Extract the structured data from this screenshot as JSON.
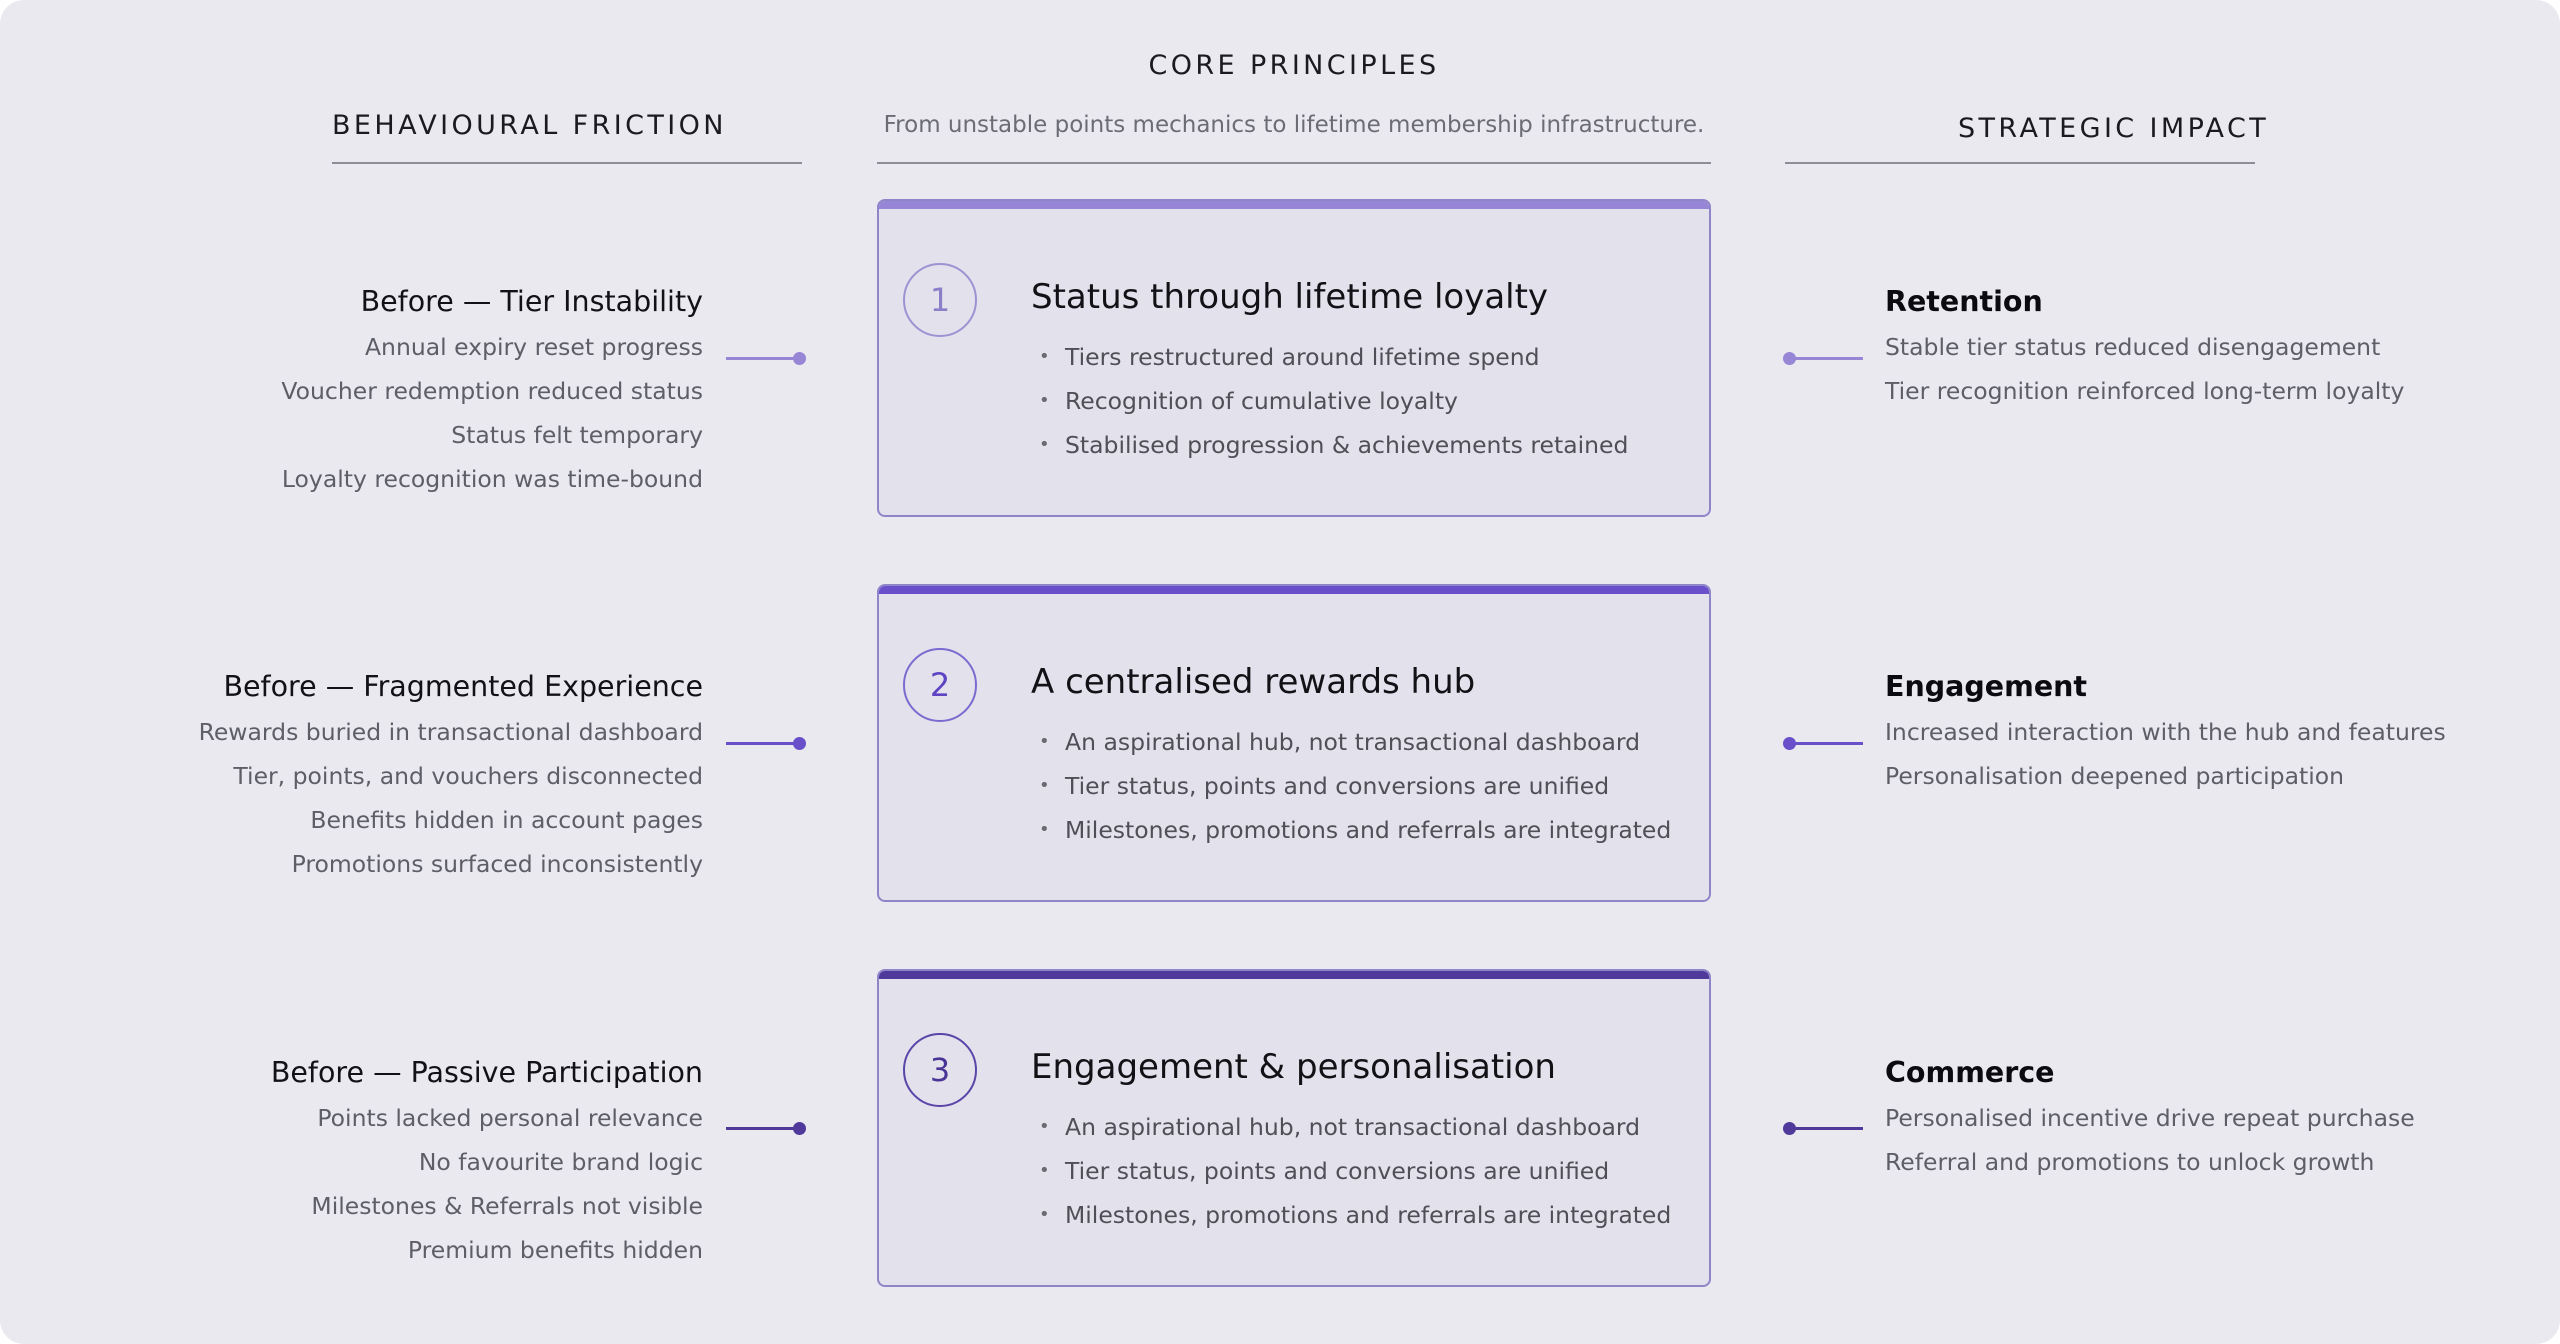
{
  "header": {
    "center_title": "CORE PRINCIPLES",
    "center_subtitle": "From unstable points mechanics to lifetime membership infrastructure.",
    "left_title": "BEHAVIOURAL FRICTION",
    "right_title": "STRATEGIC IMPACT"
  },
  "colors": {
    "background": "#e9e9ef",
    "accents": [
      "#9785d6",
      "#6a4fcb",
      "#4f3a9c"
    ]
  },
  "rows": [
    {
      "friction": {
        "title": "Before — Tier Instability",
        "items": [
          "Annual expiry reset progress",
          "Voucher redemption reduced status",
          "Status felt temporary",
          "Loyalty recognition was time-bound"
        ]
      },
      "principle": {
        "number": "1",
        "title": "Status through lifetime loyalty",
        "bullets": [
          "Tiers restructured around lifetime spend",
          "Recognition of cumulative loyalty",
          "Stabilised progression & achievements retained"
        ]
      },
      "impact": {
        "title": "Retention",
        "items": [
          "Stable tier status reduced disengagement",
          "Tier recognition reinforced long-term loyalty"
        ]
      }
    },
    {
      "friction": {
        "title": "Before — Fragmented Experience",
        "items": [
          "Rewards buried in transactional dashboard",
          "Tier, points, and vouchers disconnected",
          "Benefits hidden in account pages",
          "Promotions surfaced inconsistently"
        ]
      },
      "principle": {
        "number": "2",
        "title": "A centralised rewards hub",
        "bullets": [
          "An aspirational hub, not transactional dashboard",
          "Tier status, points and conversions are unified",
          "Milestones, promotions and referrals are integrated"
        ]
      },
      "impact": {
        "title": "Engagement",
        "items": [
          "Increased interaction with the hub and features",
          "Personalisation deepened participation"
        ]
      }
    },
    {
      "friction": {
        "title": "Before — Passive Participation",
        "items": [
          "Points lacked personal relevance",
          "No favourite brand logic",
          "Milestones & Referrals not visible",
          "Premium benefits hidden"
        ]
      },
      "principle": {
        "number": "3",
        "title": "Engagement & personalisation",
        "bullets": [
          "An aspirational hub, not transactional dashboard",
          "Tier status, points and conversions are unified",
          "Milestones, promotions and referrals are integrated"
        ]
      },
      "impact": {
        "title": "Commerce",
        "items": [
          "Personalised incentive drive repeat purchase",
          "Referral and promotions to unlock growth"
        ]
      }
    }
  ]
}
